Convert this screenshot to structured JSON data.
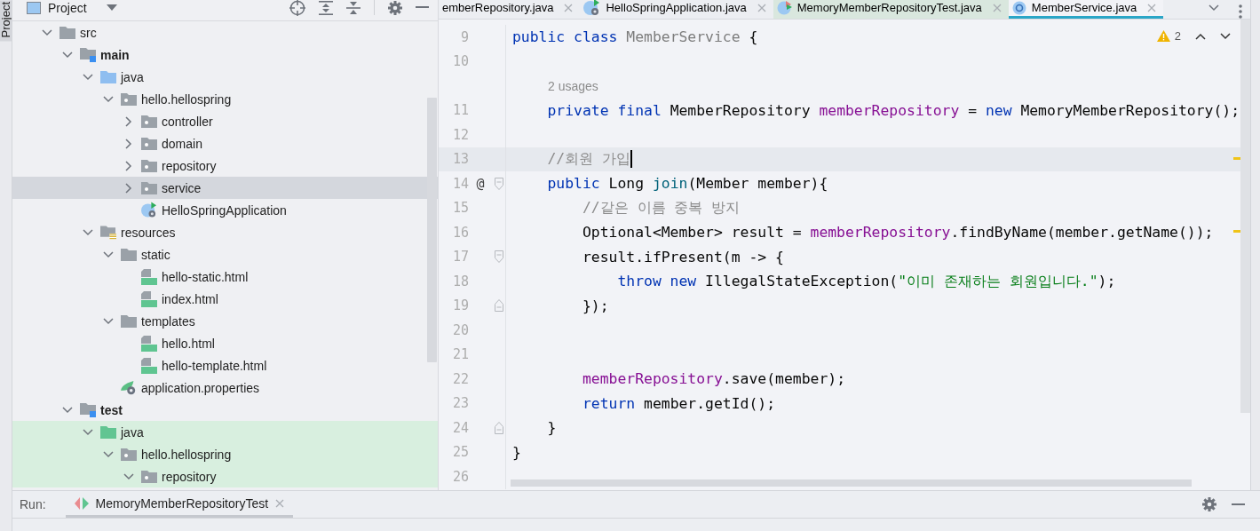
{
  "tool_strip": {
    "label": "Project"
  },
  "project": {
    "title": "Project",
    "tree": [
      {
        "label": "src",
        "kind": "folder",
        "expanded": true,
        "selected": false,
        "children": [
          {
            "label": "main",
            "kind": "source-root",
            "expanded": true,
            "selected": false,
            "children": [
              {
                "label": "java",
                "kind": "java-root",
                "expanded": true,
                "selected": false,
                "children": [
                  {
                    "label": "hello.hellospring",
                    "kind": "package",
                    "expanded": true,
                    "selected": false,
                    "children": [
                      {
                        "label": "controller",
                        "kind": "package",
                        "expanded": false,
                        "selected": false
                      },
                      {
                        "label": "domain",
                        "kind": "package",
                        "expanded": false,
                        "selected": false
                      },
                      {
                        "label": "repository",
                        "kind": "package",
                        "expanded": false,
                        "selected": false
                      },
                      {
                        "label": "service",
                        "kind": "package",
                        "expanded": false,
                        "selected": true
                      },
                      {
                        "label": "HelloSpringApplication",
                        "kind": "spring-class",
                        "selected": false
                      }
                    ]
                  }
                ]
              },
              {
                "label": "resources",
                "kind": "resources-root",
                "expanded": true,
                "selected": false,
                "children": [
                  {
                    "label": "static",
                    "kind": "folder",
                    "expanded": true,
                    "selected": false,
                    "children": [
                      {
                        "label": "hello-static.html",
                        "kind": "html",
                        "selected": false
                      },
                      {
                        "label": "index.html",
                        "kind": "html",
                        "selected": false
                      }
                    ]
                  },
                  {
                    "label": "templates",
                    "kind": "folder",
                    "expanded": true,
                    "selected": false,
                    "children": [
                      {
                        "label": "hello.html",
                        "kind": "html",
                        "selected": false
                      },
                      {
                        "label": "hello-template.html",
                        "kind": "html",
                        "selected": false
                      }
                    ]
                  },
                  {
                    "label": "application.properties",
                    "kind": "properties",
                    "selected": false
                  }
                ]
              }
            ]
          },
          {
            "label": "test",
            "kind": "test-root",
            "expanded": true,
            "selected": false,
            "children": [
              {
                "label": "java",
                "kind": "test-java-root",
                "expanded": true,
                "selected": false,
                "children": [
                  {
                    "label": "hello.hellospring",
                    "kind": "package",
                    "expanded": true,
                    "selected": false,
                    "children": [
                      {
                        "label": "repository",
                        "kind": "package",
                        "expanded": true,
                        "selected": false
                      }
                    ]
                  }
                ]
              }
            ]
          }
        ]
      }
    ]
  },
  "editor": {
    "tabs": [
      {
        "title": "emberRepository.java",
        "kind": "cut",
        "selected": false
      },
      {
        "title": "HelloSpringApplication.java",
        "kind": "spring-class",
        "selected": false
      },
      {
        "title": "MemoryMemberRepositoryTest.java",
        "kind": "test-class",
        "selected": false
      },
      {
        "title": "MemberService.java",
        "kind": "class",
        "selected": true
      }
    ],
    "warning_count": "2",
    "lines": [
      {
        "kind": "code",
        "number": "9",
        "current": false,
        "warning": false,
        "fold_start": false,
        "fold_end": false,
        "tokens": [
          {
            "kind": "keyword",
            "text": "public class "
          },
          {
            "kind": "unused",
            "text": "MemberService"
          },
          {
            "kind": "plain",
            "text": " {"
          }
        ]
      },
      {
        "kind": "code",
        "number": "10",
        "current": false,
        "warning": false,
        "fold_start": false,
        "fold_end": false
      },
      {
        "kind": "inlay",
        "text": "2 usages"
      },
      {
        "kind": "code",
        "number": "11",
        "current": false,
        "warning": false,
        "fold_start": false,
        "fold_end": false,
        "tokens": [
          {
            "kind": "keyword",
            "text": "    private final "
          },
          {
            "kind": "plain",
            "text": "MemberRepository "
          },
          {
            "kind": "field",
            "text": "memberRepository"
          },
          {
            "kind": "plain",
            "text": " = "
          },
          {
            "kind": "keyword",
            "text": "new "
          },
          {
            "kind": "plain",
            "text": "MemoryMemberRepository();"
          }
        ]
      },
      {
        "kind": "code",
        "number": "12",
        "current": false,
        "warning": false,
        "fold_start": false,
        "fold_end": false
      },
      {
        "kind": "code",
        "number": "13",
        "current": true,
        "warning": true,
        "fold_start": false,
        "fold_end": false,
        "tokens": [
          {
            "kind": "comment",
            "text": "    //회원 가입"
          }
        ]
      },
      {
        "kind": "code",
        "number": "14",
        "gutter": "@",
        "current": false,
        "warning": false,
        "fold_start": true,
        "fold_end": false,
        "tokens": [
          {
            "kind": "keyword",
            "text": "    public "
          },
          {
            "kind": "plain",
            "text": "Long "
          },
          {
            "kind": "method",
            "text": "join"
          },
          {
            "kind": "plain",
            "text": "(Member member){"
          }
        ]
      },
      {
        "kind": "code",
        "number": "15",
        "current": false,
        "warning": false,
        "fold_start": false,
        "fold_end": false,
        "tokens": [
          {
            "kind": "comment",
            "text": "        //같은 이름 중복 방지"
          }
        ]
      },
      {
        "kind": "code",
        "number": "16",
        "current": false,
        "warning": true,
        "fold_start": false,
        "fold_end": false,
        "tokens": [
          {
            "kind": "plain",
            "text": "        Optional<Member> result = "
          },
          {
            "kind": "field",
            "text": "memberRepository"
          },
          {
            "kind": "plain",
            "text": ".findByName(member.getName());"
          }
        ]
      },
      {
        "kind": "code",
        "number": "17",
        "current": false,
        "warning": false,
        "fold_start": true,
        "fold_end": false,
        "tokens": [
          {
            "kind": "plain",
            "text": "        result.ifPresent(m -> {"
          }
        ]
      },
      {
        "kind": "code",
        "number": "18",
        "current": false,
        "warning": false,
        "fold_start": false,
        "fold_end": false,
        "tokens": [
          {
            "kind": "keyword",
            "text": "            throw new "
          },
          {
            "kind": "plain",
            "text": "IllegalStateException("
          },
          {
            "kind": "string",
            "text": "\"이미 존재하는 회원입니다.\""
          },
          {
            "kind": "plain",
            "text": ");"
          }
        ]
      },
      {
        "kind": "code",
        "number": "19",
        "current": false,
        "warning": false,
        "fold_start": false,
        "fold_end": true,
        "tokens": [
          {
            "kind": "plain",
            "text": "        });"
          }
        ]
      },
      {
        "kind": "code",
        "number": "20",
        "current": false,
        "warning": false,
        "fold_start": false,
        "fold_end": false
      },
      {
        "kind": "code",
        "number": "21",
        "current": false,
        "warning": false,
        "fold_start": false,
        "fold_end": false
      },
      {
        "kind": "code",
        "number": "22",
        "current": false,
        "warning": false,
        "fold_start": false,
        "fold_end": false,
        "tokens": [
          {
            "kind": "field",
            "text": "        memberRepository"
          },
          {
            "kind": "plain",
            "text": ".save(member);"
          }
        ]
      },
      {
        "kind": "code",
        "number": "23",
        "current": false,
        "warning": false,
        "fold_start": false,
        "fold_end": false,
        "tokens": [
          {
            "kind": "keyword",
            "text": "        return "
          },
          {
            "kind": "plain",
            "text": "member.getId();"
          }
        ]
      },
      {
        "kind": "code",
        "number": "24",
        "current": false,
        "warning": false,
        "fold_start": false,
        "fold_end": true,
        "tokens": [
          {
            "kind": "plain",
            "text": "    }"
          }
        ]
      },
      {
        "kind": "code",
        "number": "25",
        "current": false,
        "warning": false,
        "fold_start": false,
        "fold_end": false,
        "tokens": [
          {
            "kind": "plain",
            "text": "}"
          }
        ]
      },
      {
        "kind": "code",
        "number": "26",
        "current": false,
        "warning": false,
        "fold_start": false,
        "fold_end": false
      }
    ]
  },
  "run": {
    "label": "Run:",
    "tabs": [
      {
        "title": "MemoryMemberRepositoryTest",
        "selected": true
      }
    ]
  }
}
